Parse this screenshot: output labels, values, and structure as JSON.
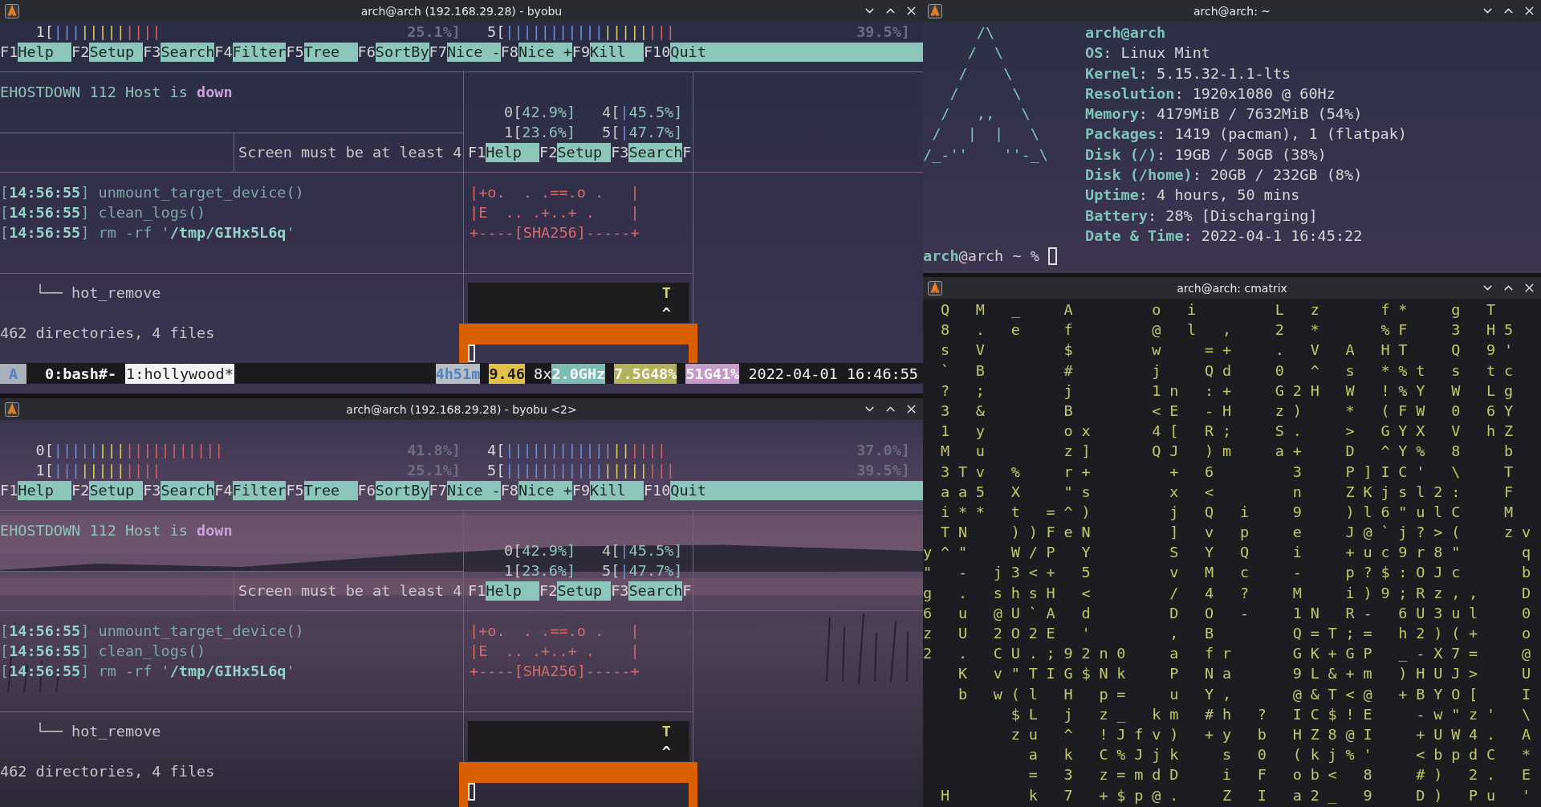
{
  "left_windows": [
    {
      "title": "arch@arch (192.168.29.28) - byobu",
      "cpu_meters": [
        [
          {
            "label": "1[",
            "segments": [
              {
                "bars": "|||",
                "color": "#6f8fd2"
              },
              {
                "bars": "|||||",
                "color": "#d8cb5a"
              },
              {
                "bars": "||||",
                "color": "#d45f62"
              }
            ],
            "value": "25.1%]"
          },
          {
            "label": "5[",
            "segments": [
              {
                "bars": "|||||||||||",
                "color": "#6f8fd2"
              },
              {
                "bars": "|||||",
                "color": "#d8cb5a"
              },
              {
                "bars": "|||",
                "color": "#d45f62"
              }
            ],
            "value": "39.5%]"
          }
        ]
      ],
      "function_keys": [
        {
          "key": "F1",
          "label": "Help"
        },
        {
          "key": "F2",
          "label": "Setup"
        },
        {
          "key": "F3",
          "label": "Search"
        },
        {
          "key": "F4",
          "label": "Filter"
        },
        {
          "key": "F5",
          "label": "Tree"
        },
        {
          "key": "F6",
          "label": "SortBy"
        },
        {
          "key": "F7",
          "label": "Nice -"
        },
        {
          "key": "F8",
          "label": "Nice +"
        },
        {
          "key": "F9",
          "label": "Kill"
        },
        {
          "key": "F10",
          "label": "Quit"
        }
      ],
      "error": "EHOSTDOWN 112 Host is **down**",
      "notice": "Screen must be at least 4",
      "mini_cpus": [
        [
          {
            "label": "0[",
            "value": "42.9%]"
          },
          {
            "label": "4[",
            "bars": "|",
            "value": "45.5%]"
          }
        ],
        [
          {
            "label": "1[",
            "value": "23.6%]"
          },
          {
            "label": "5[",
            "bars": "|",
            "value": "47.7%]"
          }
        ]
      ],
      "mini_function_keys": [
        {
          "key": "F1",
          "label": "Help"
        },
        {
          "key": "F2",
          "label": "Setup"
        },
        {
          "key": "F3",
          "label": "Search"
        },
        {
          "key": "F"
        }
      ],
      "log": [
        "[**14:56:55**] unmount_target_device()",
        "[**14:56:55**] clean_logs()",
        "[**14:56:55**] rm -rf '**/tmp/GIHx5L6q**'"
      ],
      "fingerprint": [
        "|+o.  . .==.o .   |",
        "|E  .. .+..+ .    |",
        "+----[SHA256]-----+"
      ],
      "tree_line": "└── hot_remove",
      "summary": "462 directories, 4 files",
      "preview": [
        "T",
        "^"
      ],
      "status_bar": {
        "session": "A",
        "windows": [
          {
            "label": "0:bash#-",
            "selected": false
          },
          {
            "label": "1:hollywood*",
            "selected": true
          }
        ],
        "indicators": [
          [
            {
              "text": "4h51m",
              "kind": "uptime",
              "color": "#b7bec6"
            }
          ],
          [
            {
              "text": "9.46",
              "kind": "load",
              "color": "#e2c24a"
            }
          ],
          [
            {
              "text": "8x",
              "kind": "cores"
            },
            {
              "text": "2.0GHz",
              "kind": "speed",
              "color": "#7cbcb2"
            }
          ],
          [
            {
              "text": "7.5G48%",
              "kind": "memory",
              "color": "#b3b25a"
            }
          ],
          [
            {
              "text": "51G41%",
              "kind": "disk",
              "color": "#c59cc9"
            }
          ]
        ],
        "clock": "2022-04-01 16:46:55"
      }
    },
    {
      "title": "arch@arch (192.168.29.28) - byobu <2>",
      "wallpaper": {
        "kind": "picture"
      },
      "cpu_meters": [
        [
          {
            "label": "0[",
            "segments": [
              {
                "bars": "|||||",
                "color": "#6f8fd2"
              },
              {
                "bars": "|||",
                "color": "#d8cb5a"
              },
              {
                "bars": "|||||||||||",
                "color": "#d45f62"
              }
            ],
            "value": "41.8%]"
          },
          {
            "label": "4[",
            "segments": [
              {
                "bars": "||||||||||||",
                "color": "#6f8fd2"
              },
              {
                "bars": "||",
                "color": "#d8cb5a"
              },
              {
                "bars": "||||",
                "color": "#d45f62"
              }
            ],
            "value": "37.0%]"
          }
        ],
        [
          {
            "label": "1[",
            "segments": [
              {
                "bars": "|||",
                "color": "#6f8fd2"
              },
              {
                "bars": "|||||",
                "color": "#d8cb5a"
              },
              {
                "bars": "||||",
                "color": "#d45f62"
              }
            ],
            "value": "25.1%]"
          },
          {
            "label": "5[",
            "segments": [
              {
                "bars": "|||||||||||",
                "color": "#6f8fd2"
              },
              {
                "bars": "|||||",
                "color": "#d8cb5a"
              },
              {
                "bars": "|||",
                "color": "#d45f62"
              }
            ],
            "value": "39.5%]"
          }
        ]
      ],
      "function_keys": [
        {
          "key": "F1",
          "label": "Help"
        },
        {
          "key": "F2",
          "label": "Setup"
        },
        {
          "key": "F3",
          "label": "Search"
        },
        {
          "key": "F4",
          "label": "Filter"
        },
        {
          "key": "F5",
          "label": "Tree"
        },
        {
          "key": "F6",
          "label": "SortBy"
        },
        {
          "key": "F7",
          "label": "Nice -"
        },
        {
          "key": "F8",
          "label": "Nice +"
        },
        {
          "key": "F9",
          "label": "Kill"
        },
        {
          "key": "F10",
          "label": "Quit"
        }
      ],
      "error": "EHOSTDOWN 112 Host is **down**",
      "notice": "Screen must be at least 4",
      "mini_cpus": [
        [
          {
            "label": "0[",
            "value": "42.9%]"
          },
          {
            "label": "4[",
            "bars": "|",
            "value": "45.5%]"
          }
        ],
        [
          {
            "label": "1[",
            "value": "23.6%]"
          },
          {
            "label": "5[",
            "bars": "|",
            "value": "47.7%]"
          }
        ]
      ],
      "mini_function_keys": [
        {
          "key": "F1",
          "label": "Help"
        },
        {
          "key": "F2",
          "label": "Setup"
        },
        {
          "key": "F3",
          "label": "Search"
        },
        {
          "key": "F"
        }
      ],
      "log": [
        "[**14:56:55**] unmount_target_device()",
        "[**14:56:55**] clean_logs()",
        "[**14:56:55**] rm -rf '**/tmp/GIHx5L6q**'"
      ],
      "fingerprint": [
        "|+o.  . .==.o .   |",
        "|E  .. .+..+ .    |",
        "+----[SHA256]-----+"
      ],
      "tree_line": "└── hot_remove",
      "summary": "462 directories, 4 files",
      "preview": [
        "T",
        "^"
      ]
    }
  ],
  "neofetch": {
    "title": "arch@arch: ~",
    "art": [
      "      /\\",
      "     /  \\",
      "    /    \\",
      "   /      \\",
      "  /   ,,   \\",
      " /   |  |   \\",
      "/_-''    ''-_\\"
    ],
    "header": "arch@arch",
    "fields": [
      "**OS**: Linux Mint",
      "**Kernel**: 5.15.32-1.1-lts",
      "**Resolution**: 1920x1080 @ 60Hz",
      "**Memory**: 4179MiB / 7632MiB (54%)",
      "**Packages**: 1419 (pacman), 1 (flatpak)",
      "**Disk (/)**: 19GB / 50GB (38%)",
      "**Disk (/home)**: 20GB / 232GB (8%)",
      "**Uptime**: 4 hours, 50 mins",
      "**Battery**: 28% [Discharging]",
      "**Date & Time**: 2022-04-1 16:45:22"
    ],
    "prompt": "**arch**@arch ~ %"
  },
  "cmatrix": {
    "title": "arch@arch: cmatrix",
    "rows": [
      " Q M _  A    o i    L z   f*  g T",
      " 8 . e  f    @ l ,  2 *   %F  3 H5",
      " s V    $    w  =+  . V A HT  Q 9'",
      " ` B    #    j  Qd  0 ^ s *%t s tc",
      " ? ;    j    1n :+  G2H W !%Y W Lg",
      " 3 &    B    <E -H  z)  * (FW 0 6Y",
      " 1 y    ox   4[ R;  S.  > GYX V hZ",
      " M u    z]   QJ )m  a+  D ^Y% 8  b",
      " 3Tv %  r+    + 6    3  P]IC' \\  T",
      " aa5 X  \"s    x <    n  ZKjsl2:  F",
      " i** t =^)    j Q i  9  )l6\"ulC  M",
      " TN  ))FeN    ] v p  e  J@`j?>(  zv",
      "y^\"  W/P Y    S Y Q  i  +uc9r8\"   q",
      "\" - j3<+ 5    v M c  -  p?$:OJc   b",
      "g . shsH <    / 4 ?  M  i)9;Rz,,  D",
      "6 u @U`A d    D O -  1N R- 6U3ul  0",
      "z U 2O2E '    , B    Q=T;= h2)(+  o",
      "2 . CU.;92n0  a fr   GK+GP _-X7=  @",
      "  K v\"TIG$Nk  P Na   9L&+m )HUJ>  U",
      "  b w(l H p=  u Y,   @&T<@ +BYO[  I",
      "     $L j z_ km #h ? IC$!E  -w\"z' \\",
      "     zu ^ !Jfv) +y b HZ8@I  +UW4. A",
      "      a k C%Jjk  s 0 (kj%'  <bpdC *",
      "      = 3 z=mdD  i F ob< 8  #) 2. E",
      " H    k 7 +$p@.  Z I a2_ 9  D) Pu '"
    ]
  }
}
